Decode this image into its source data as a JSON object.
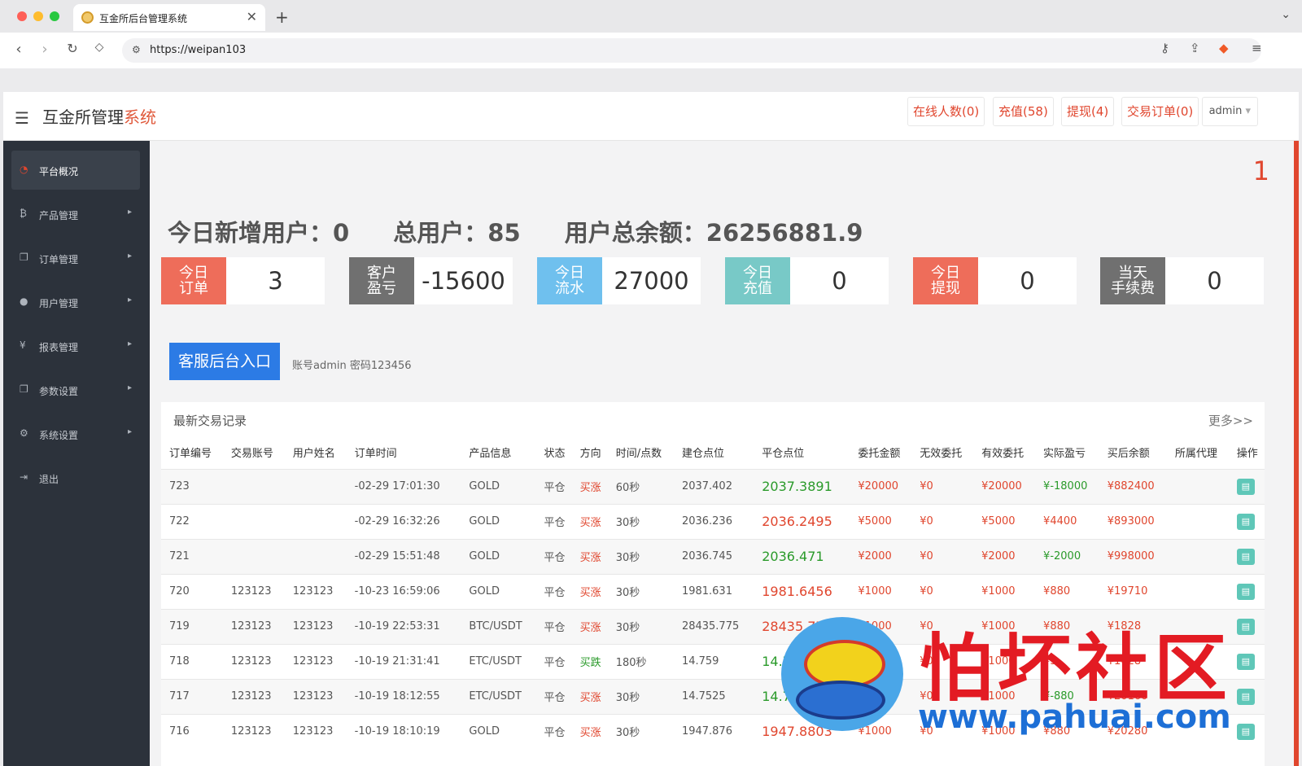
{
  "browser": {
    "tab_title": "互金所后台管理系统",
    "url": "https://weipan103",
    "new_tab": "+",
    "close_tab": "✕"
  },
  "header": {
    "brand_a": "互金所管理",
    "brand_b": "系统",
    "online": "在线人数(0)",
    "recharge": "充值(58)",
    "withdraw": "提现(4)",
    "orders": "交易订单(0)",
    "user": "admin",
    "user_caret": "▾"
  },
  "sidebar": {
    "items": [
      {
        "label": "平台概况",
        "icon": "dashboard-icon"
      },
      {
        "label": "产品管理",
        "icon": "bitcoin-icon"
      },
      {
        "label": "订单管理",
        "icon": "copy-icon"
      },
      {
        "label": "用户管理",
        "icon": "user-icon"
      },
      {
        "label": "报表管理",
        "icon": "yen-icon"
      },
      {
        "label": "参数设置",
        "icon": "copy-icon"
      },
      {
        "label": "系统设置",
        "icon": "gears-icon"
      },
      {
        "label": "退出",
        "icon": "logout-icon"
      }
    ]
  },
  "main": {
    "corner_number": "1",
    "summary": {
      "new_users": "今日新增用户：0",
      "total_users": "总用户：85",
      "total_balance": "用户总余额：26256881.9"
    },
    "cards": [
      {
        "label1": "今日",
        "label2": "订单",
        "value": "3",
        "color": "#ee6d5a"
      },
      {
        "label1": "客户",
        "label2": "盈亏",
        "value": "-15600",
        "color": "#707070"
      },
      {
        "label1": "今日",
        "label2": "流水",
        "value": "27000",
        "color": "#6fc0ee"
      },
      {
        "label1": "今日",
        "label2": "充值",
        "value": "0",
        "color": "#78c9c7"
      },
      {
        "label1": "今日",
        "label2": "提现",
        "value": "0",
        "color": "#ee6d5a"
      },
      {
        "label1": "当天",
        "label2": "手续费",
        "value": "0",
        "color": "#707070"
      }
    ],
    "kf_button": "客服后台入口",
    "kf_note": "账号admin 密码123456"
  },
  "panel": {
    "title": "最新交易记录",
    "more": "更多>>",
    "headers": [
      "订单编号",
      "交易账号",
      "用户姓名",
      "订单时间",
      "产品信息",
      "状态",
      "方向",
      "时间/点数",
      "建仓点位",
      "平仓点位",
      "委托金额",
      "无效委托",
      "有效委托",
      "实际盈亏",
      "买后余额",
      "所属代理",
      "操作"
    ],
    "rows": [
      [
        "723",
        "",
        "",
        "-02-29 17:01:30",
        "GOLD",
        "平仓",
        "买涨",
        "60秒",
        "2037.402",
        "2037.3891",
        "¥20000",
        "¥0",
        "¥20000",
        "¥-18000",
        "¥882400",
        ""
      ],
      [
        "722",
        "",
        "",
        "-02-29 16:32:26",
        "GOLD",
        "平仓",
        "买涨",
        "30秒",
        "2036.236",
        "2036.2495",
        "¥5000",
        "¥0",
        "¥5000",
        "¥4400",
        "¥893000",
        ""
      ],
      [
        "721",
        "",
        "",
        "-02-29 15:51:48",
        "GOLD",
        "平仓",
        "买涨",
        "30秒",
        "2036.745",
        "2036.471",
        "¥2000",
        "¥0",
        "¥2000",
        "¥-2000",
        "¥998000",
        ""
      ],
      [
        "720",
        "123123",
        "123123",
        "-10-23 16:59:06",
        "GOLD",
        "平仓",
        "买涨",
        "30秒",
        "1981.631",
        "1981.6456",
        "¥1000",
        "¥0",
        "¥1000",
        "¥880",
        "¥19710",
        ""
      ],
      [
        "719",
        "123123",
        "123123",
        "-10-19 22:53:31",
        "BTC/USDT",
        "平仓",
        "买涨",
        "30秒",
        "28435.775",
        "28435.779",
        "¥1000",
        "¥0",
        "¥1000",
        "¥880",
        "¥1828",
        ""
      ],
      [
        "718",
        "123123",
        "123123",
        "-10-19 21:31:41",
        "ETC/USDT",
        "平仓",
        "买跌",
        "180秒",
        "14.759",
        "14.7",
        "¥1000",
        "¥0",
        "¥1000",
        "¥5",
        "¥1028",
        ""
      ],
      [
        "717",
        "123123",
        "123123",
        "-10-19 18:12:55",
        "ETC/USDT",
        "平仓",
        "买涨",
        "30秒",
        "14.7525",
        "14.75",
        "¥1000",
        "¥0",
        "¥1000",
        "¥-880",
        "¥20160",
        ""
      ],
      [
        "716",
        "123123",
        "123123",
        "-10-19 18:10:19",
        "GOLD",
        "平仓",
        "买涨",
        "30秒",
        "1947.876",
        "1947.8803",
        "¥1000",
        "¥0",
        "¥1000",
        "¥880",
        "¥20280",
        ""
      ]
    ]
  },
  "watermark": {
    "text": "怕坏社区",
    "site": "www.pahuai.com"
  }
}
